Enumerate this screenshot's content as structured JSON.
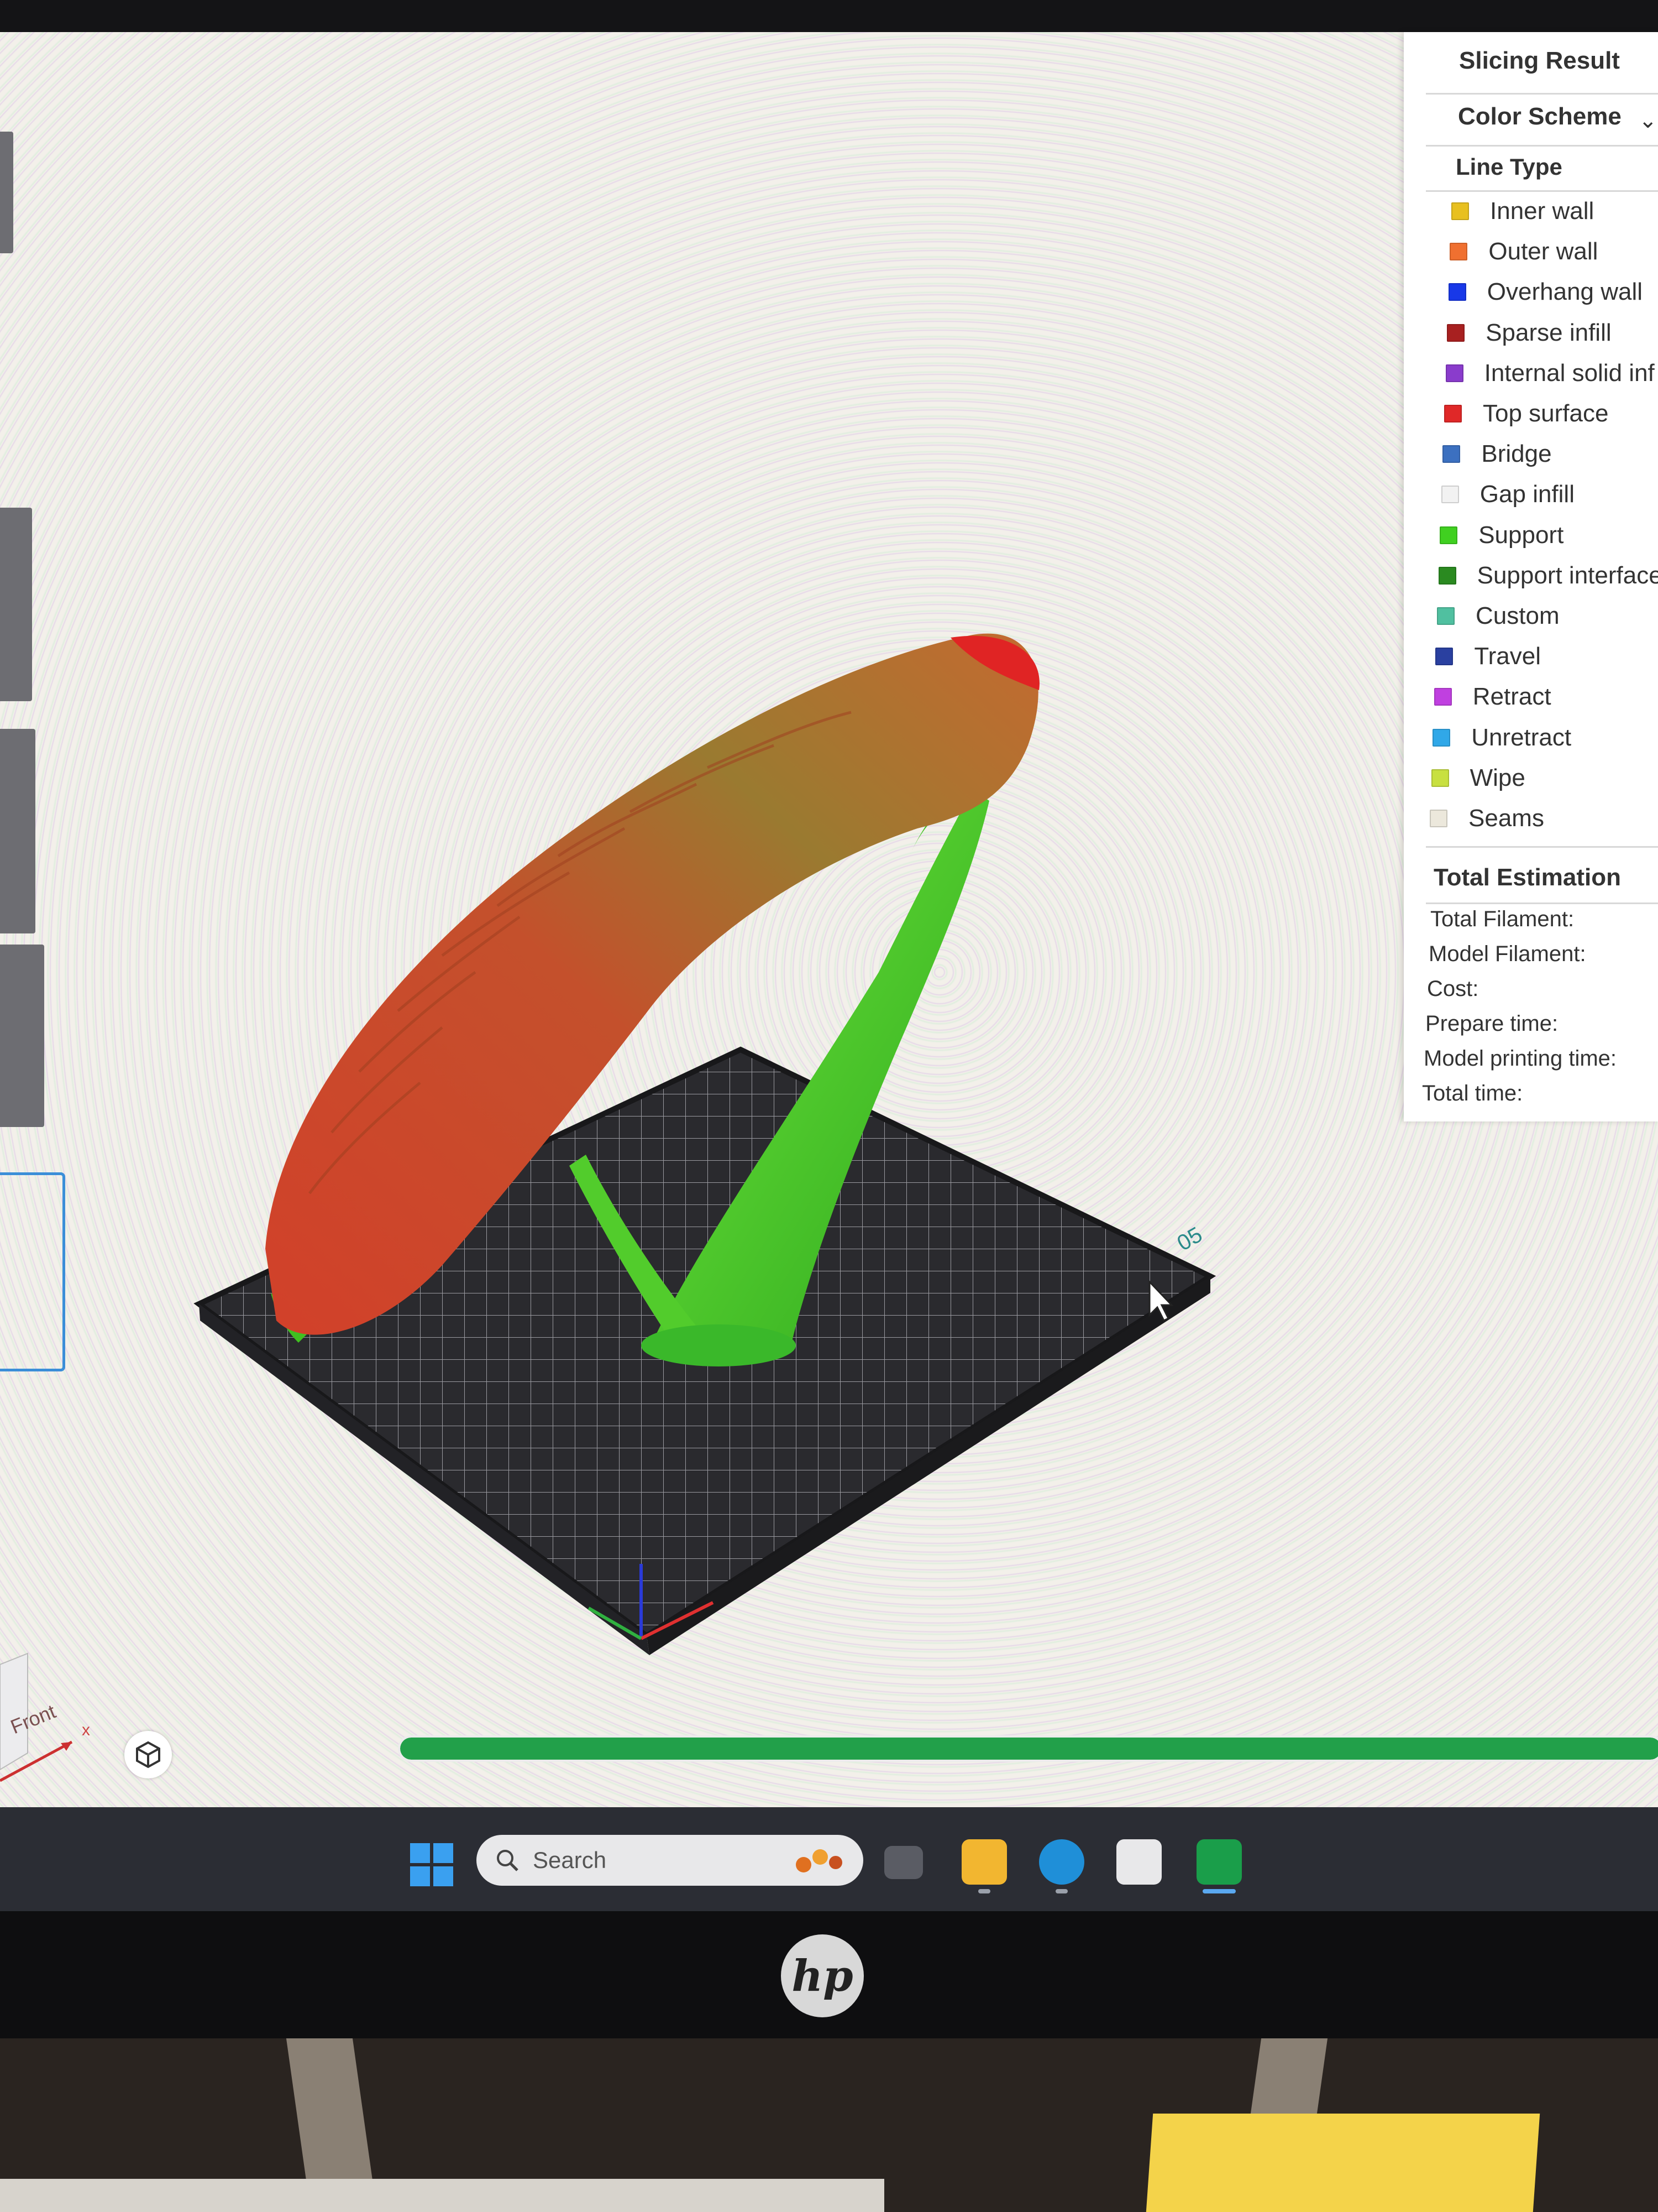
{
  "panel": {
    "title": "Slicing Result",
    "color_scheme_label": "Color Scheme",
    "line_type_label": "Line Type",
    "legend": [
      {
        "label": "Inner wall",
        "color": "#e8c020"
      },
      {
        "label": "Outer wall",
        "color": "#f07030"
      },
      {
        "label": "Overhang wall",
        "color": "#1838e8"
      },
      {
        "label": "Sparse infill",
        "color": "#a82020"
      },
      {
        "label": "Internal solid inf",
        "color": "#8a3ccc"
      },
      {
        "label": "Top surface",
        "color": "#e02828"
      },
      {
        "label": "Bridge",
        "color": "#3c70c0"
      },
      {
        "label": "Gap infill",
        "color": "#f2f2f2"
      },
      {
        "label": "Support",
        "color": "#40d020"
      },
      {
        "label": "Support interface",
        "color": "#2a8a20"
      },
      {
        "label": "Custom",
        "color": "#50c0a0"
      },
      {
        "label": "Travel",
        "color": "#2a40a0"
      },
      {
        "label": "Retract",
        "color": "#c040e0"
      },
      {
        "label": "Unretract",
        "color": "#30a8e8"
      },
      {
        "label": "Wipe",
        "color": "#c8e040"
      },
      {
        "label": "Seams",
        "color": "#ece8dc"
      }
    ],
    "total_estimation_label": "Total Estimation",
    "estimates": [
      "Total Filament:",
      "Model Filament:",
      "Cost:",
      "Prepare time:",
      "Model printing time:",
      "Total time:"
    ]
  },
  "viewport": {
    "nav_cube_label": "Front",
    "axis_x_label": "x",
    "plate_number": "05",
    "progress_fraction": 1.0
  },
  "taskbar": {
    "search_placeholder": "Search"
  },
  "monitor": {
    "brand": "hp"
  }
}
